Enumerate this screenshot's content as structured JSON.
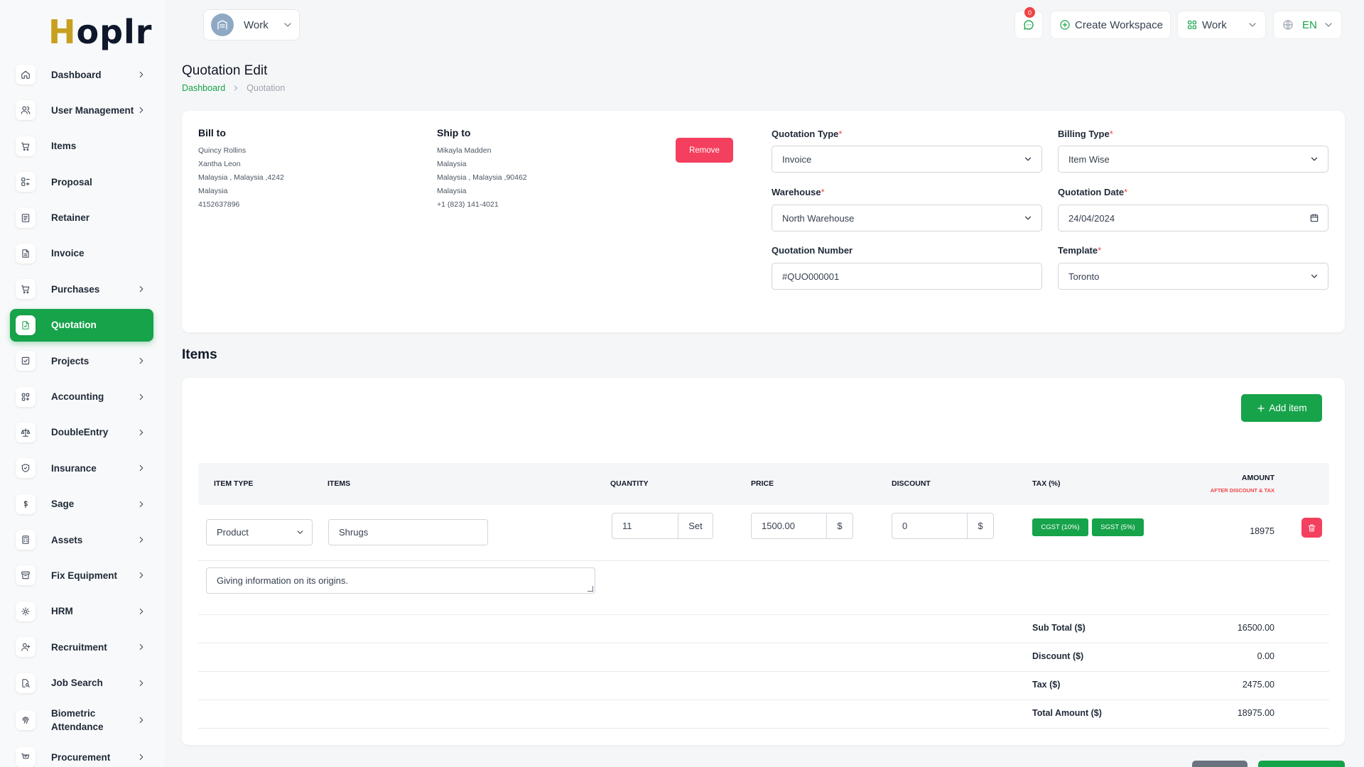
{
  "brand": {
    "logo_prefix": "H",
    "logo_rest": "oplr"
  },
  "sidebar": {
    "items": [
      {
        "label": "Dashboard",
        "icon": "home-icon",
        "chevron": true
      },
      {
        "label": "User Management",
        "icon": "users-icon",
        "chevron": true
      },
      {
        "label": "Items",
        "icon": "cart-icon",
        "chevron": false
      },
      {
        "label": "Proposal",
        "icon": "proposal-icon",
        "chevron": false
      },
      {
        "label": "Retainer",
        "icon": "retainer-icon",
        "chevron": false
      },
      {
        "label": "Invoice",
        "icon": "file-icon",
        "chevron": false
      },
      {
        "label": "Purchases",
        "icon": "cart-icon",
        "chevron": true
      },
      {
        "label": "Quotation",
        "icon": "file-check-icon",
        "chevron": false,
        "active": true
      },
      {
        "label": "Projects",
        "icon": "checkbox-icon",
        "chevron": true
      },
      {
        "label": "Accounting",
        "icon": "grid-icon",
        "chevron": true
      },
      {
        "label": "DoubleEntry",
        "icon": "scale-icon",
        "chevron": true
      },
      {
        "label": "Insurance",
        "icon": "shield-icon",
        "chevron": true
      },
      {
        "label": "Sage",
        "icon": "dollar-icon",
        "chevron": true
      },
      {
        "label": "Assets",
        "icon": "calculator-icon",
        "chevron": true
      },
      {
        "label": "Fix Equipment",
        "icon": "archive-icon",
        "chevron": true
      },
      {
        "label": "HRM",
        "icon": "hrm-icon",
        "chevron": true
      },
      {
        "label": "Recruitment",
        "icon": "user-plus-icon",
        "chevron": true
      },
      {
        "label": "Job Search",
        "icon": "file-search-icon",
        "chevron": true
      },
      {
        "label": "Biometric Attendance",
        "icon": "fingerprint-icon",
        "chevron": true
      },
      {
        "label": "Procurement",
        "icon": "procurement-icon",
        "chevron": true
      }
    ]
  },
  "header": {
    "workspace": "Work",
    "message_count": "0",
    "create_workspace": "Create Workspace",
    "work_menu": "Work",
    "language": "EN"
  },
  "page": {
    "title": "Quotation Edit",
    "breadcrumb": [
      "Dashboard",
      "Quotation"
    ]
  },
  "bill_to": {
    "heading": "Bill to",
    "lines": [
      "Quincy Rollins",
      "Xantha Leon",
      "Malaysia , Malaysia ,4242",
      "Malaysia",
      "4152637896"
    ]
  },
  "ship_to": {
    "heading": "Ship to",
    "lines": [
      "Mikayla Madden",
      "Malaysia",
      "Malaysia , Malaysia ,90462",
      "Malaysia",
      "+1 (823) 141-4021"
    ]
  },
  "remove_label": "Remove",
  "form": {
    "quotation_type": {
      "label": "Quotation Type",
      "value": "Invoice"
    },
    "billing_type": {
      "label": "Billing Type",
      "value": "Item Wise"
    },
    "warehouse": {
      "label": "Warehouse",
      "value": "North Warehouse"
    },
    "quotation_date": {
      "label": "Quotation Date",
      "value": "24/04/2024"
    },
    "quotation_number": {
      "label": "Quotation Number",
      "value": "#QUO000001"
    },
    "template": {
      "label": "Template",
      "value": "Toronto"
    },
    "required_mark": "*"
  },
  "items_section": {
    "title": "Items",
    "add_item": "Add item",
    "columns": {
      "item_type": "ITEM TYPE",
      "items": "ITEMS",
      "quantity": "QUANTITY",
      "price": "PRICE",
      "discount": "DISCOUNT",
      "tax": "TAX (%)",
      "amount": "AMOUNT",
      "amount_sub": "AFTER DISCOUNT & TAX"
    },
    "row": {
      "item_type": "Product",
      "item": "Shrugs",
      "quantity": "11",
      "unit": "Set",
      "price": "1500.00",
      "currency": "$",
      "discount": "0",
      "taxes": [
        "CGST (10%)",
        "SGST (5%)"
      ],
      "amount": "18975",
      "description": "Giving information on its origins."
    }
  },
  "totals": [
    {
      "label": "Sub Total ($)",
      "value": "16500.00"
    },
    {
      "label": "Discount ($)",
      "value": "0.00"
    },
    {
      "label": "Tax ($)",
      "value": "2475.00"
    },
    {
      "label": "Total Amount ($)",
      "value": "18975.00"
    }
  ],
  "colors": {
    "primary": "#16a34a",
    "danger": "#f43f5e"
  }
}
